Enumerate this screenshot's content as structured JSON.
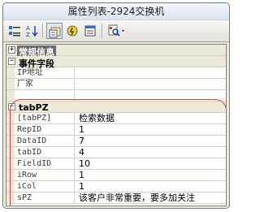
{
  "window": {
    "title": "属性列表-2924交换机"
  },
  "toolbar": {
    "buttons": [
      {
        "name": "categorized-button",
        "icon": "categorized-icon"
      },
      {
        "name": "alphabetical-button",
        "icon": "sort-az-icon"
      },
      {
        "name": "properties-button",
        "icon": "properties-icon"
      },
      {
        "name": "events-button",
        "icon": "events-icon"
      },
      {
        "name": "pages-button",
        "icon": "pages-icon"
      },
      {
        "name": "search-dropdown-button",
        "icon": "search-icon"
      }
    ]
  },
  "grid": {
    "categories": {
      "general": {
        "label": "常规信息",
        "expanded": false
      },
      "events": {
        "label": "事件字段",
        "expanded": true
      },
      "tabpz": {
        "label": "tabPZ",
        "expanded": true
      }
    },
    "event_rows": [
      {
        "name": "IP地址",
        "value": ""
      },
      {
        "name": "厂家",
        "value": ""
      }
    ],
    "tabpz_rows": [
      {
        "name": "[tabPZ]",
        "value": "检索数据"
      },
      {
        "name": "RepID",
        "value": "1"
      },
      {
        "name": "DataID",
        "value": "7"
      },
      {
        "name": "tabID",
        "value": "4"
      },
      {
        "name": "FieldID",
        "value": "10"
      },
      {
        "name": "iRow",
        "value": "1"
      },
      {
        "name": "iCol",
        "value": "1"
      },
      {
        "name": "sPZ",
        "value": "该客户非常重要，要多加关注"
      }
    ]
  },
  "colors": {
    "highlight_oval": "#c0504d",
    "selected_category": "#6d6d6d"
  }
}
